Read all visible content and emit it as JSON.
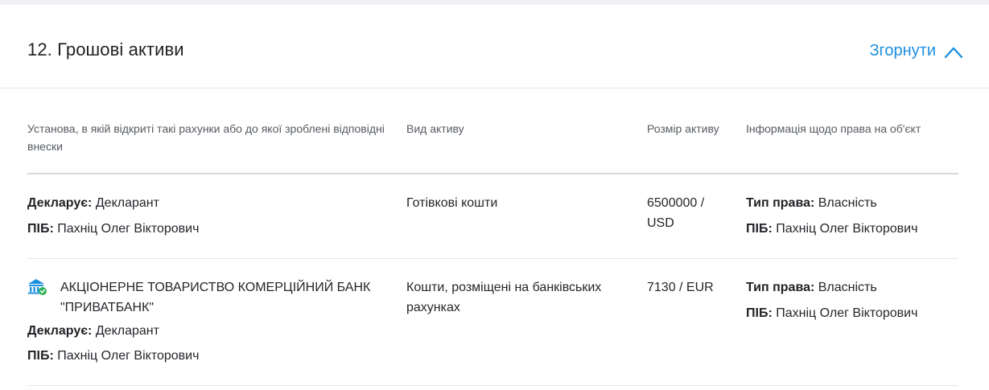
{
  "section": {
    "title": "12. Грошові активи",
    "collapse_label": "Згорнути"
  },
  "table": {
    "headers": [
      "Установа, в якій відкриті такі рахунки або до якої зроблені відповідні внески",
      "Вид активу",
      "Розмір активу",
      "Інформація щодо права на об'єкт"
    ],
    "rows": [
      {
        "institution": "",
        "declares_label": "Декларує:",
        "declares_value": "Декларант",
        "pib_label": "ПІБ:",
        "pib_value": "Пахніц Олег Вікторович",
        "asset_type": "Готівкові кошти",
        "asset_size": "6500000 / USD",
        "right_type_label": "Тип права:",
        "right_type_value": "Власність",
        "right_pib_label": "ПІБ:",
        "right_pib_value": "Пахніц Олег Вікторович"
      },
      {
        "institution": "АКЦІОНЕРНЕ ТОВАРИСТВО КОМЕРЦІЙНИЙ БАНК \"ПРИВАТБАНК\"",
        "declares_label": "Декларує:",
        "declares_value": "Декларант",
        "pib_label": "ПІБ:",
        "pib_value": "Пахніц Олег Вікторович",
        "asset_type": "Кошти, розміщені на банківських рахунках",
        "asset_size": "7130 / EUR",
        "right_type_label": "Тип права:",
        "right_type_value": "Власність",
        "right_pib_label": "ПІБ:",
        "right_pib_value": "Пахніц Олег Вікторович"
      }
    ]
  },
  "colors": {
    "accent": "#1d8fe0",
    "bank_icon": "#1d8fe0",
    "verified_badge": "#2fb35a"
  },
  "icons": {
    "collapse": "chevron-up-icon",
    "bank": "bank-icon",
    "verified": "check-badge-icon"
  }
}
